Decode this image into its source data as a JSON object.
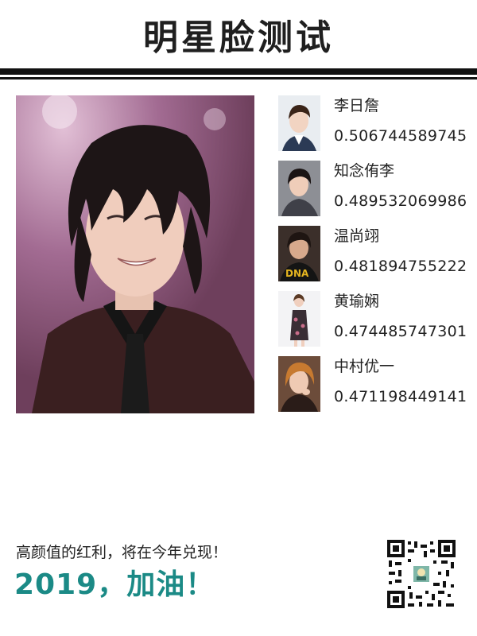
{
  "page": {
    "title": "明星脸测试"
  },
  "matches": [
    {
      "name": "李日詹",
      "score": "0.506744589745"
    },
    {
      "name": "知念侑李",
      "score": "0.489532069986"
    },
    {
      "name": "温尚翊",
      "score": "0.481894755222"
    },
    {
      "name": "黄瑜娴",
      "score": "0.474485747301"
    },
    {
      "name": "中村优一",
      "score": "0.471198449141"
    }
  ],
  "footer": {
    "line1": "高颜值的红利，将在今年兑现！",
    "line2": "2019，加油！"
  },
  "colors": {
    "accent": "#1b8a86",
    "title": "#1f1f1f",
    "rule": "#111111"
  },
  "icons": {
    "qr": "qr-code-icon"
  }
}
